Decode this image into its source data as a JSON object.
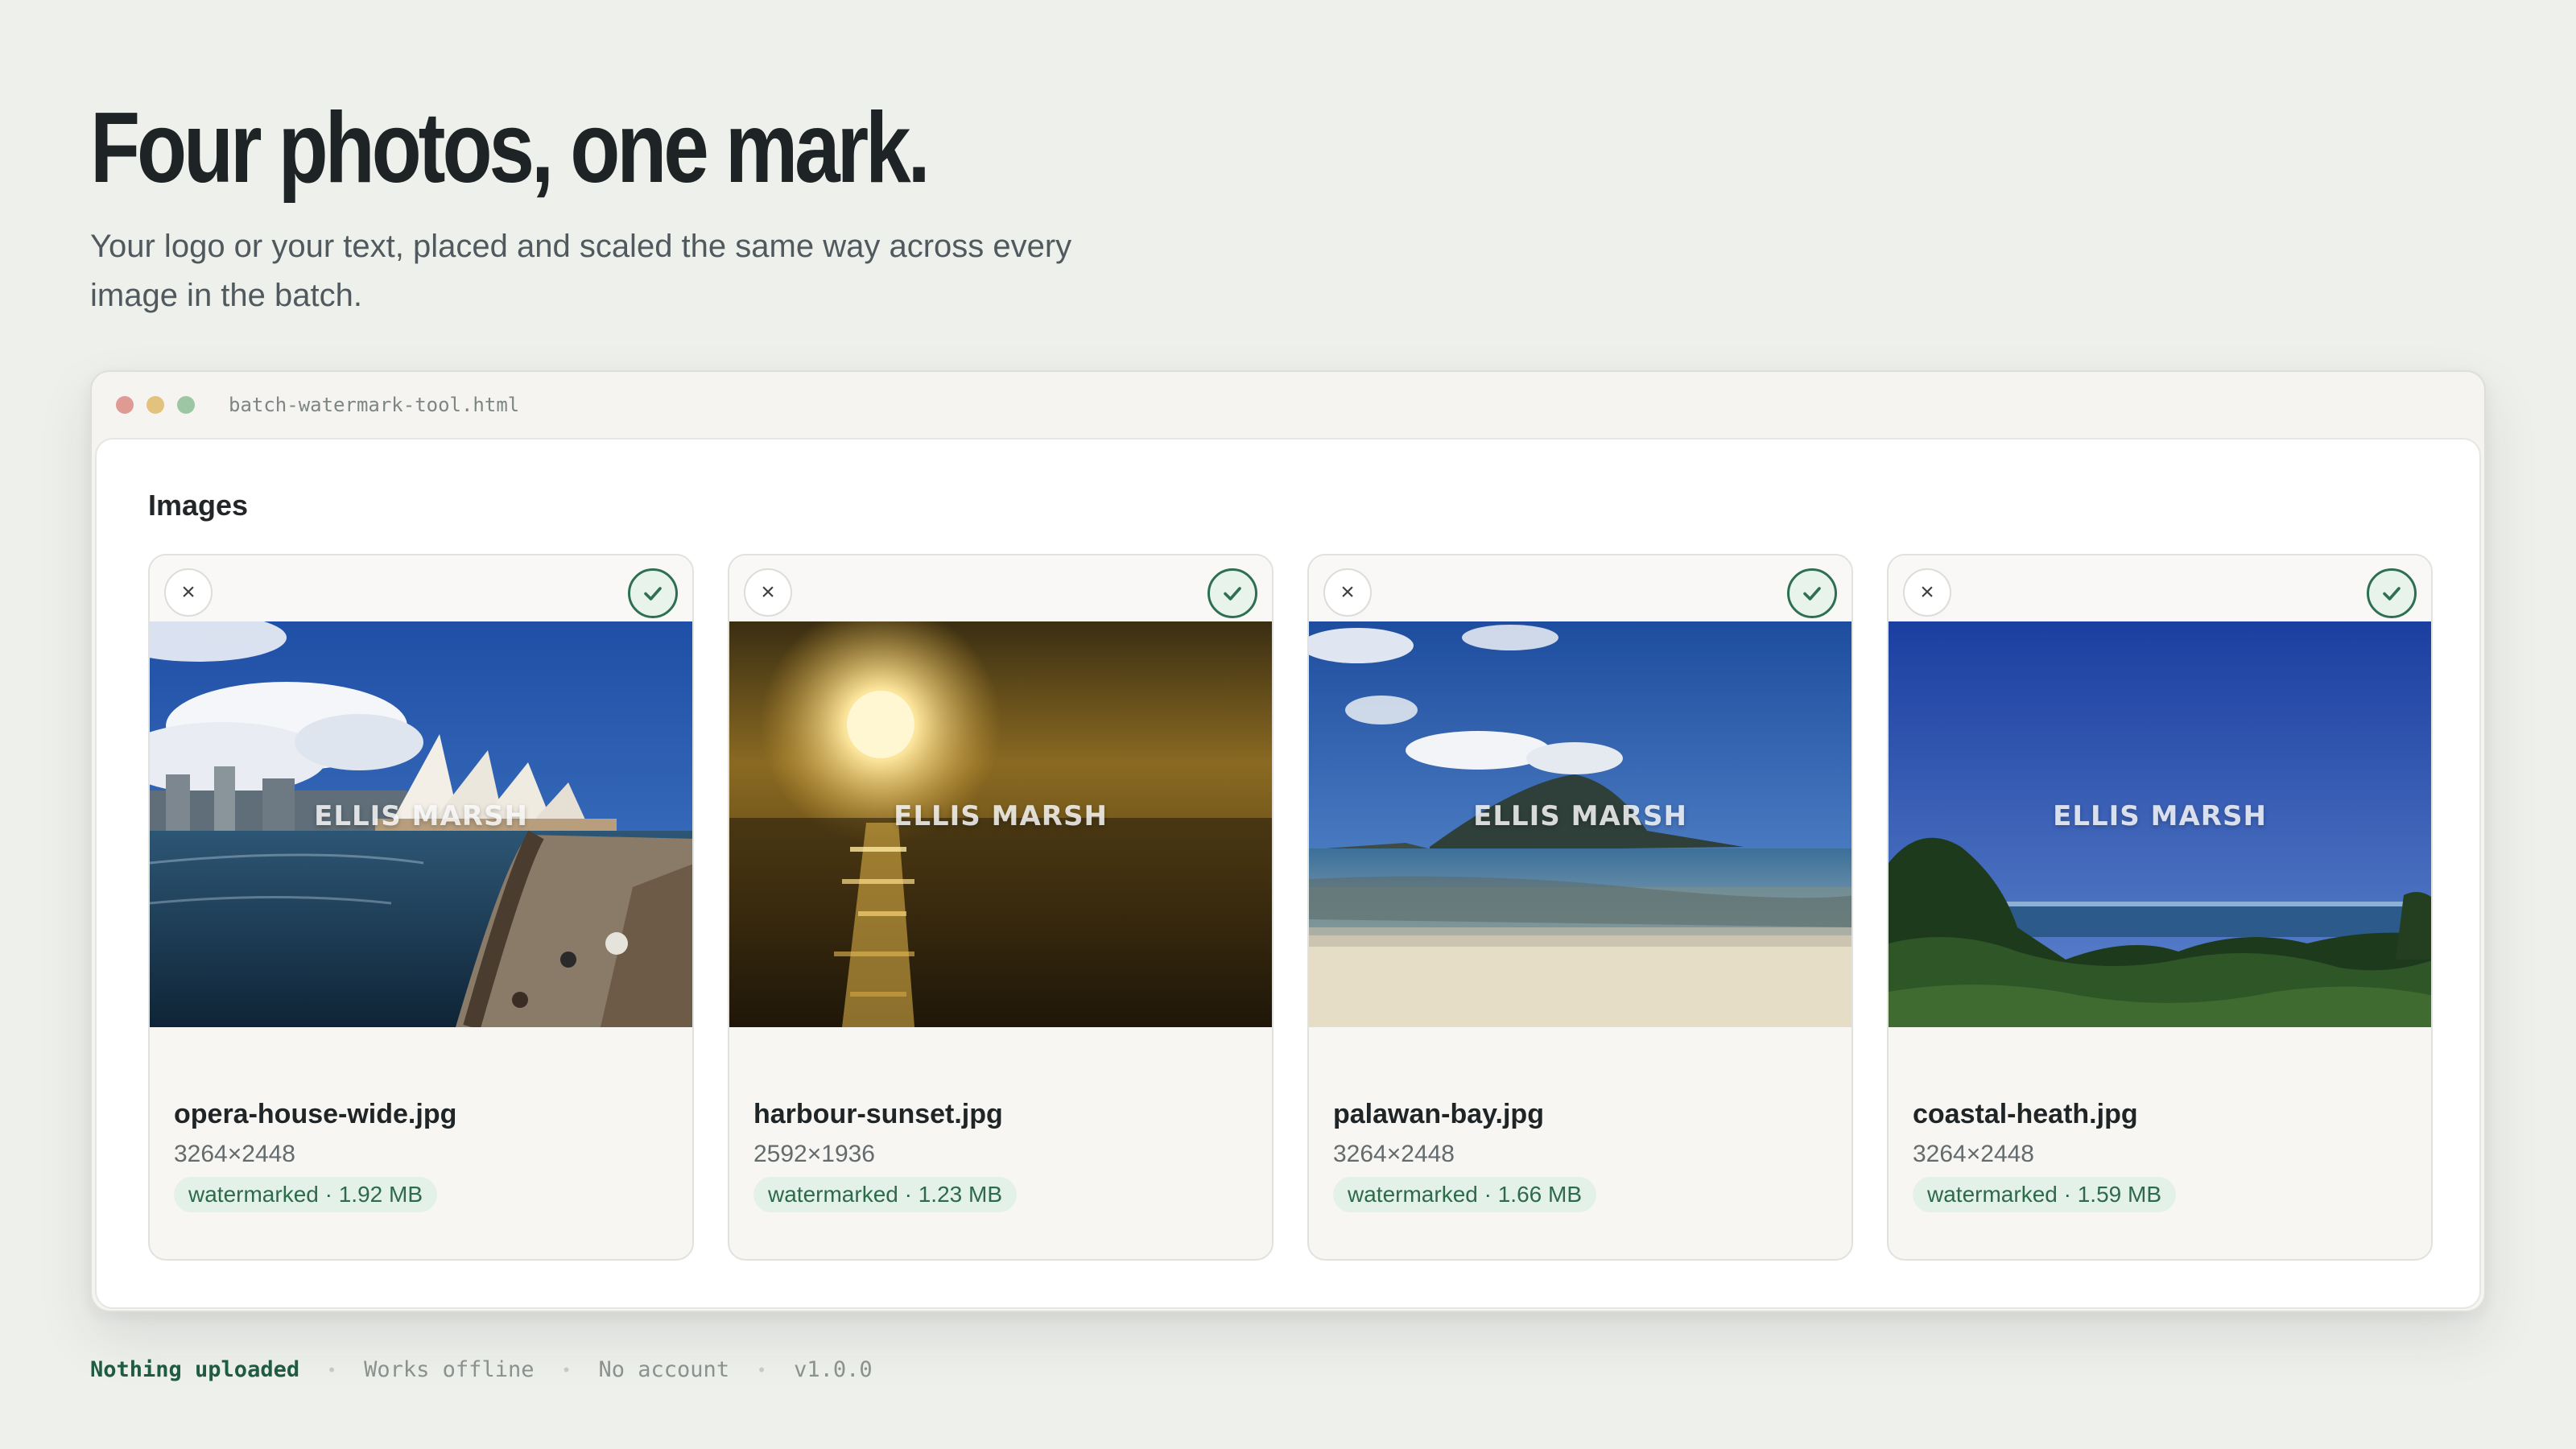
{
  "hero": {
    "title": "Four photos, one mark.",
    "subtitle": "Your logo or your text, placed and scaled the same way across every image in the batch."
  },
  "window": {
    "file_name": "batch-watermark-tool.html"
  },
  "section": {
    "title": "Images"
  },
  "watermark_text": "ELLIS MARSH",
  "icons": {
    "remove": "close-icon",
    "done": "check-icon"
  },
  "colors": {
    "accent": "#2e6f52",
    "status_bg": "#e3f1e8",
    "status_text": "#2d6a4b",
    "page_bg": "#eef0ec"
  },
  "cards": [
    {
      "file_name": "opera-house-wide.jpg",
      "dimensions": "3264×2448",
      "status": "watermarked · 1.92 MB",
      "remove_label": "×"
    },
    {
      "file_name": "harbour-sunset.jpg",
      "dimensions": "2592×1936",
      "status": "watermarked · 1.23 MB",
      "remove_label": "×"
    },
    {
      "file_name": "palawan-bay.jpg",
      "dimensions": "3264×2448",
      "status": "watermarked · 1.66 MB",
      "remove_label": "×"
    },
    {
      "file_name": "coastal-heath.jpg",
      "dimensions": "3264×2448",
      "status": "watermarked · 1.59 MB",
      "remove_label": "×"
    }
  ],
  "footer": {
    "privacy": "Nothing uploaded",
    "offline": "Works offline",
    "account": "No account",
    "version": "v1.0.0",
    "separator": "•"
  }
}
